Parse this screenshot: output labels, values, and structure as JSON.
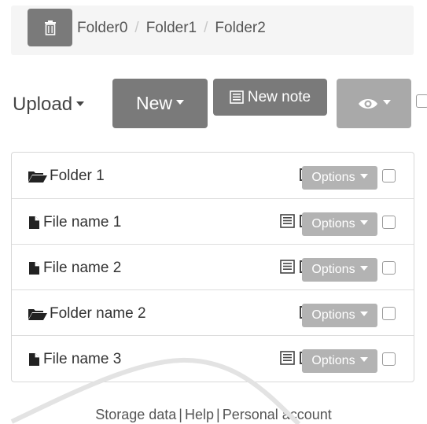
{
  "breadcrumb": [
    "Folder0",
    "Folder1",
    "Folder2"
  ],
  "toolbar": {
    "upload_label": "Upload",
    "new_label": "New",
    "new_note_label": "New note"
  },
  "rows": [
    {
      "kind": "folder",
      "name": "Folder 1",
      "options": "Options"
    },
    {
      "kind": "file",
      "name": "File name 1",
      "options": "Options"
    },
    {
      "kind": "file",
      "name": "File name 2",
      "options": "Options"
    },
    {
      "kind": "folder",
      "name": "Folder name 2",
      "options": "Options"
    },
    {
      "kind": "file",
      "name": "File name 3",
      "options": "Options"
    }
  ],
  "footer": {
    "storage": "Storage data",
    "help": "Help",
    "account": "Personal account",
    "separator": "|"
  },
  "colors": {
    "button_dark": "#7a7a7a",
    "button_light": "#a9a9a9",
    "options_bg": "#b3b3b3"
  }
}
